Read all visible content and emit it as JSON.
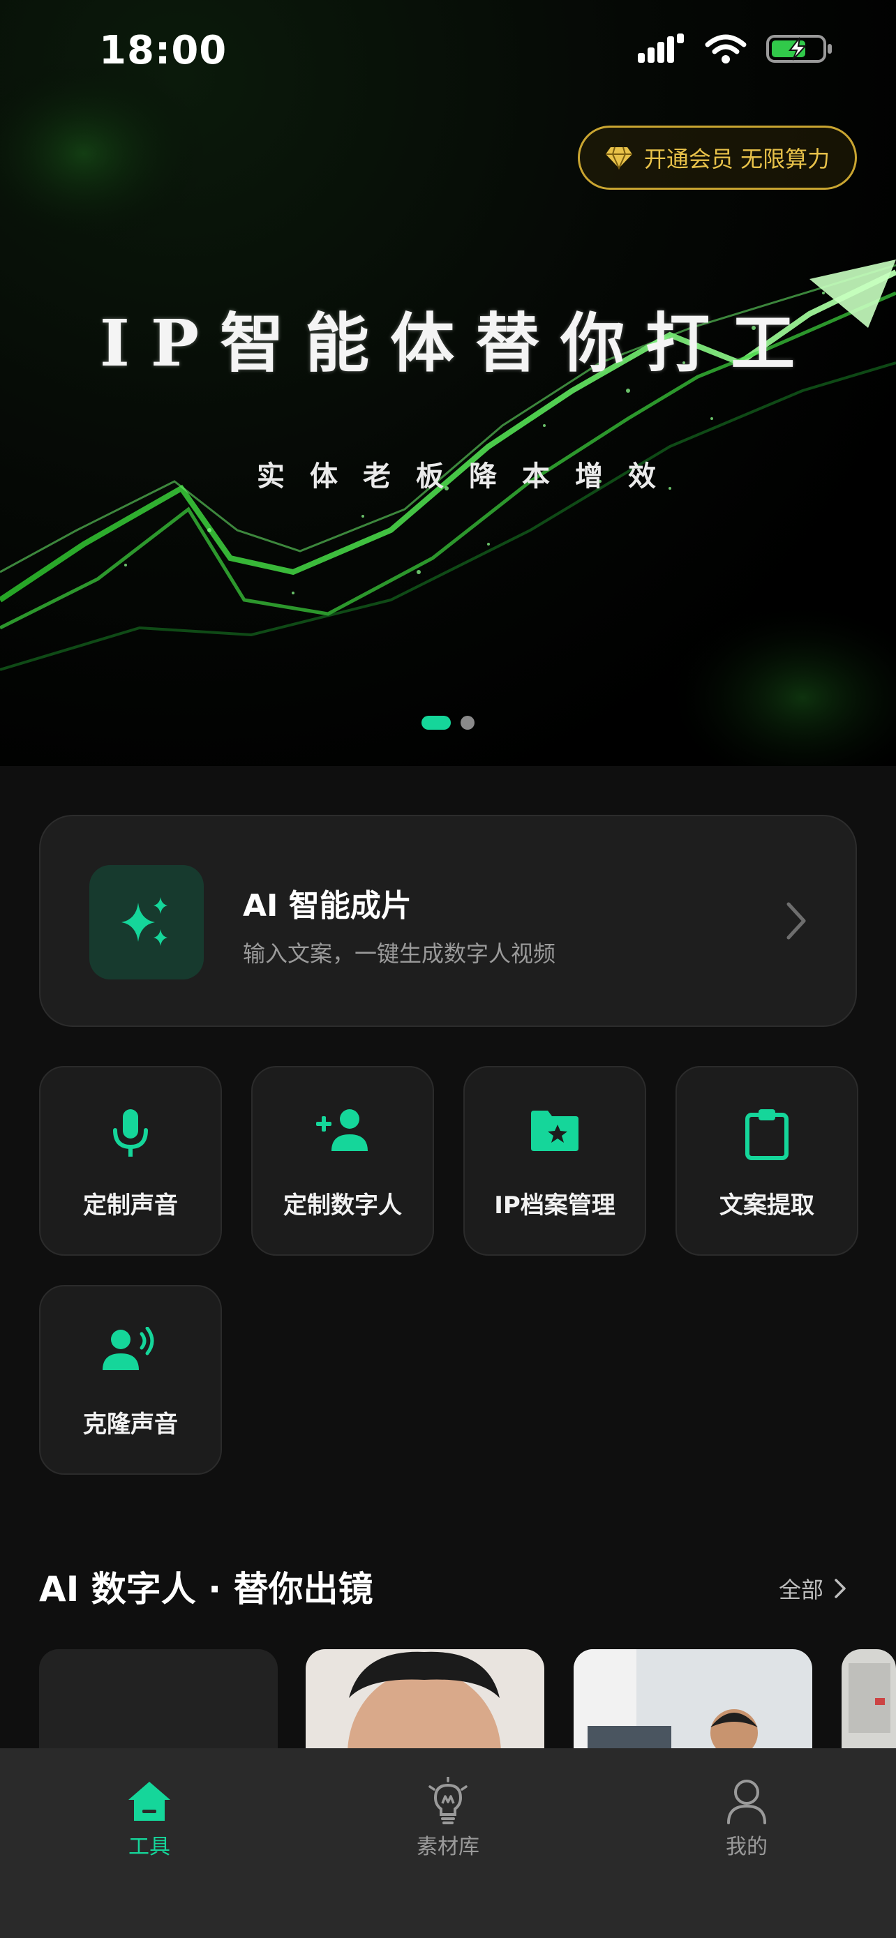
{
  "status_bar": {
    "time": "18:00"
  },
  "hero": {
    "vip_button": "开通会员 无限算力",
    "title": "IP智能体替你打工",
    "subtitle": "实体老板降本增效",
    "carousel_pages": 2,
    "carousel_active": 1
  },
  "ai_card": {
    "title": "AI 智能成片",
    "description": "输入文案，一键生成数字人视频"
  },
  "tools": [
    {
      "label": "定制声音",
      "icon": "microphone-icon"
    },
    {
      "label": "定制数字人",
      "icon": "add-person-icon"
    },
    {
      "label": "IP档案管理",
      "icon": "star-folder-icon"
    },
    {
      "label": "文案提取",
      "icon": "clipboard-icon"
    },
    {
      "label": "克隆声音",
      "icon": "voice-person-icon"
    }
  ],
  "section": {
    "title": "AI 数字人 · 替你出镜",
    "all_label": "全部"
  },
  "tabbar": {
    "items": [
      {
        "label": "工具",
        "icon": "home-icon",
        "active": true
      },
      {
        "label": "素材库",
        "icon": "lightbulb-icon",
        "active": false
      },
      {
        "label": "我的",
        "icon": "person-icon",
        "active": false
      }
    ]
  },
  "colors": {
    "accent": "#15d69a",
    "gold": "#e8c24a",
    "background": "#0f0f0f",
    "card": "#1e1e1e",
    "tabbar": "#2a2a2a"
  }
}
